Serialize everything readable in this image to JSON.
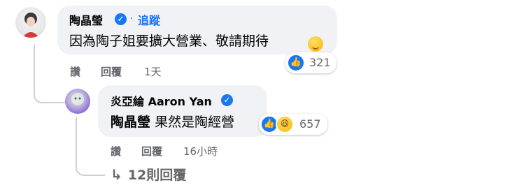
{
  "comment": {
    "author": "陶晶瑩",
    "separator": "·",
    "follow_label": "追蹤",
    "text": "因為陶子姐要擴大營業、敬請期待",
    "reaction_count": "321",
    "actions": {
      "like": "讚",
      "reply": "回覆"
    },
    "time": "1天"
  },
  "reply": {
    "author": "炎亞綸 Aaron Yan",
    "mention": "陶晶瑩",
    "text": "果然是陶經營",
    "reaction_count": "657",
    "actions": {
      "like": "讚",
      "reply": "回覆"
    },
    "time": "16小時"
  },
  "more_replies": {
    "label": "12則回覆"
  },
  "colors": {
    "accent": "#1877f2",
    "bubble": "#f0f2f5",
    "muted": "#65676b"
  }
}
